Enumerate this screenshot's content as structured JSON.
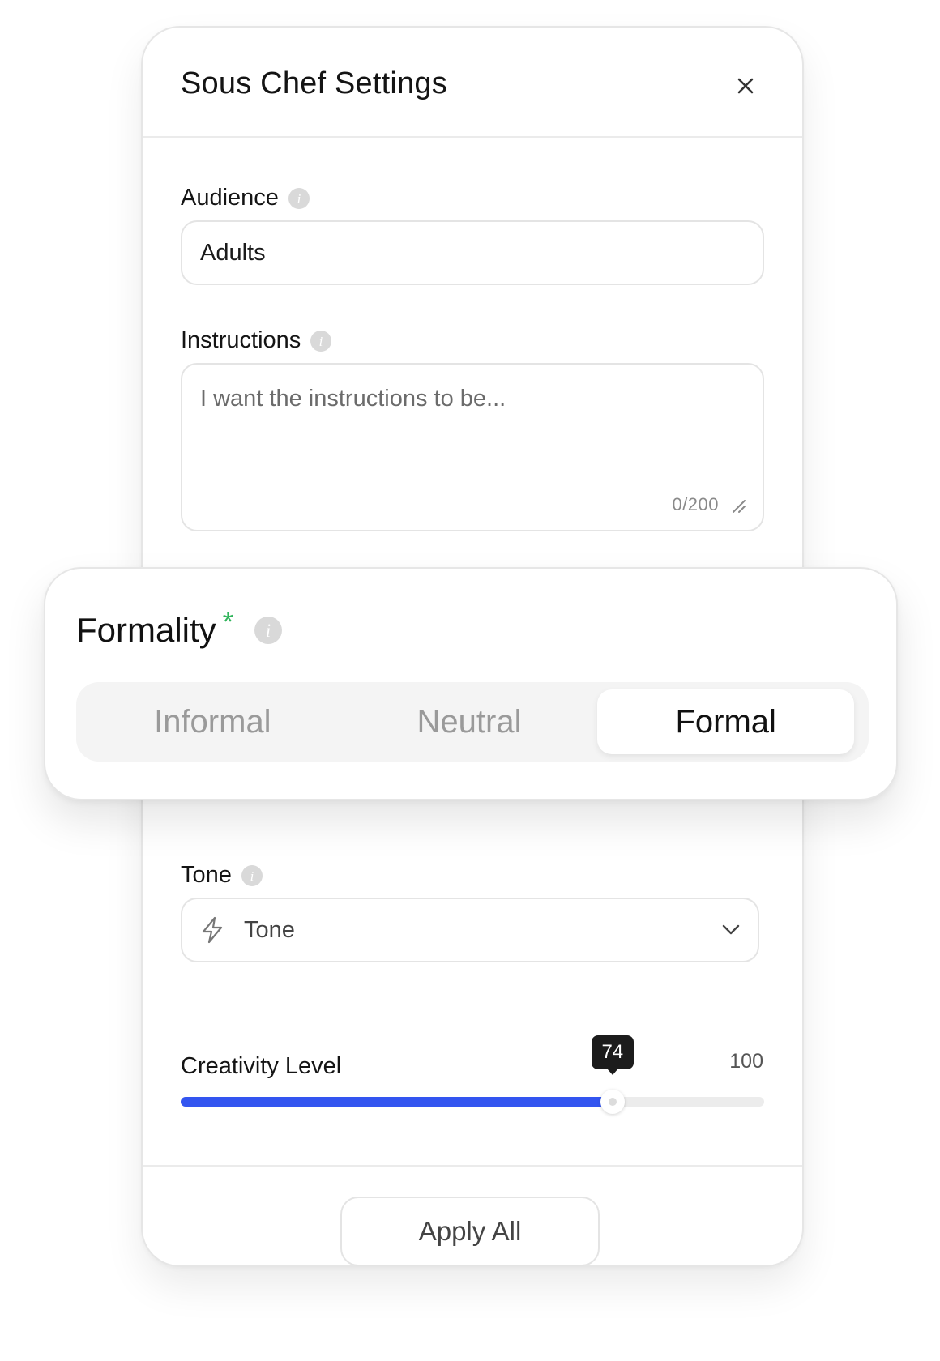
{
  "dialog": {
    "title": "Sous Chef Settings",
    "close_icon": "close-icon"
  },
  "audience": {
    "label": "Audience",
    "value": "Adults"
  },
  "instructions": {
    "label": "Instructions",
    "placeholder": "I want the instructions to be...",
    "char_count": "0/200"
  },
  "formality": {
    "label": "Formality",
    "required_mark": "*",
    "options": [
      "Informal",
      "Neutral",
      "Formal"
    ],
    "selected": "Formal"
  },
  "tone": {
    "label": "Tone",
    "placeholder": "Tone",
    "icon": "bolt-icon"
  },
  "creativity": {
    "label": "Creativity Level",
    "value": 74,
    "value_label": "74",
    "max": 100,
    "max_label": "100"
  },
  "footer": {
    "apply_label": "Apply All"
  },
  "colors": {
    "accent": "#3355f0",
    "required": "#2fb45a"
  }
}
